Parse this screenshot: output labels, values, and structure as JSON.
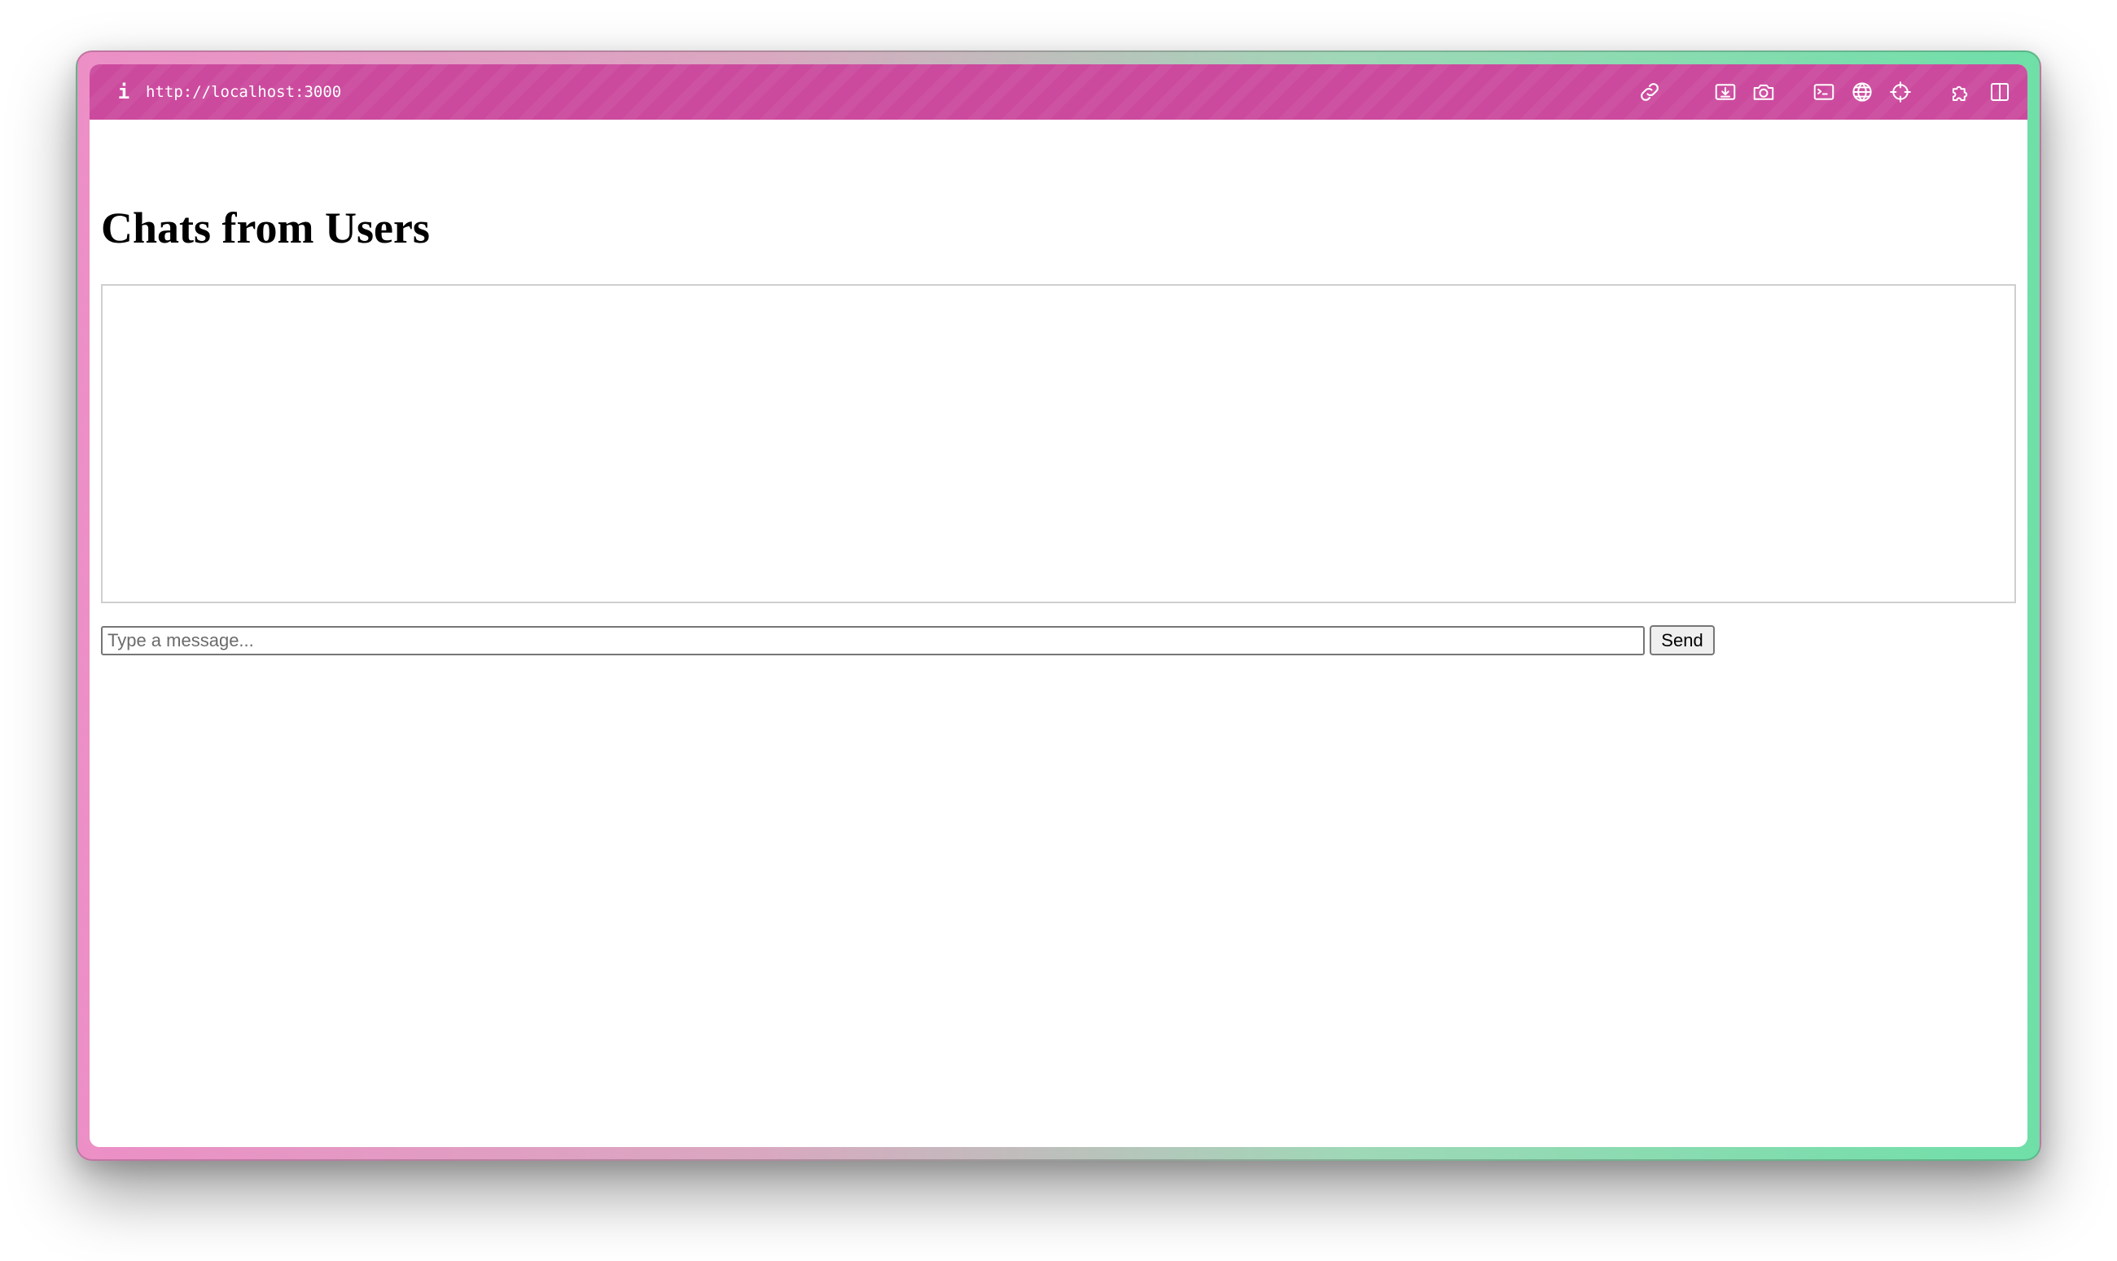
{
  "browser": {
    "url": "http://localhost:3000",
    "toolbar_color": "#cc4a9e",
    "icons": [
      "info-icon",
      "link-icon",
      "screen-capture-icon",
      "camera-icon",
      "terminal-icon",
      "globe-icon",
      "crosshair-icon",
      "extension-icon",
      "split-view-icon"
    ]
  },
  "page": {
    "title": "Chats from Users",
    "chat_messages": [],
    "message_input": {
      "value": "",
      "placeholder": "Type a message..."
    },
    "send_label": "Send"
  }
}
